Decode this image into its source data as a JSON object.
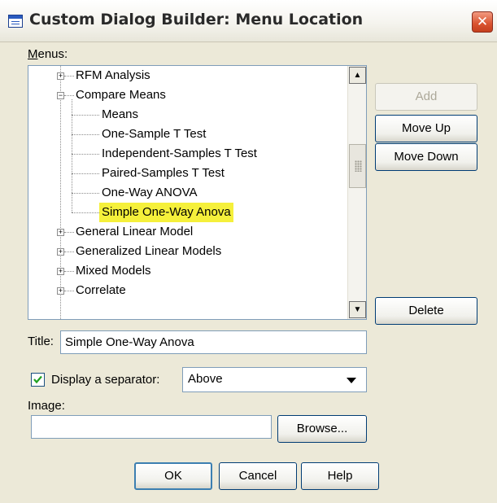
{
  "window": {
    "title": "Custom Dialog Builder: Menu Location",
    "close_symbol": "✕"
  },
  "menus_label": "Menus:",
  "tree": {
    "items": [
      {
        "label": "RFM Analysis",
        "level": 1,
        "expander": "+"
      },
      {
        "label": "Compare Means",
        "level": 1,
        "expander": "−"
      },
      {
        "label": "Means",
        "level": 2,
        "expander": ""
      },
      {
        "label": "One-Sample T Test",
        "level": 2,
        "expander": ""
      },
      {
        "label": "Independent-Samples T Test",
        "level": 2,
        "expander": ""
      },
      {
        "label": "Paired-Samples T Test",
        "level": 2,
        "expander": ""
      },
      {
        "label": "One-Way ANOVA",
        "level": 2,
        "expander": ""
      },
      {
        "label": "Simple One-Way Anova",
        "level": 2,
        "expander": "",
        "selected": true
      },
      {
        "label": "General Linear Model",
        "level": 1,
        "expander": "+"
      },
      {
        "label": "Generalized Linear Models",
        "level": 1,
        "expander": "+"
      },
      {
        "label": "Mixed Models",
        "level": 1,
        "expander": "+"
      },
      {
        "label": "Correlate",
        "level": 1,
        "expander": "+"
      }
    ],
    "selection_color": "#f5f03b"
  },
  "buttons": {
    "add": "Add",
    "move_up": "Move Up",
    "move_down": "Move Down",
    "delete": "Delete",
    "browse": "Browse...",
    "ok": "OK",
    "cancel": "Cancel",
    "help": "Help"
  },
  "title_field": {
    "label": "Title:",
    "value": "Simple One-Way Anova"
  },
  "separator": {
    "label": "Display a separator:",
    "checked": true,
    "value": "Above"
  },
  "image_field": {
    "label": "Image:",
    "value": ""
  }
}
